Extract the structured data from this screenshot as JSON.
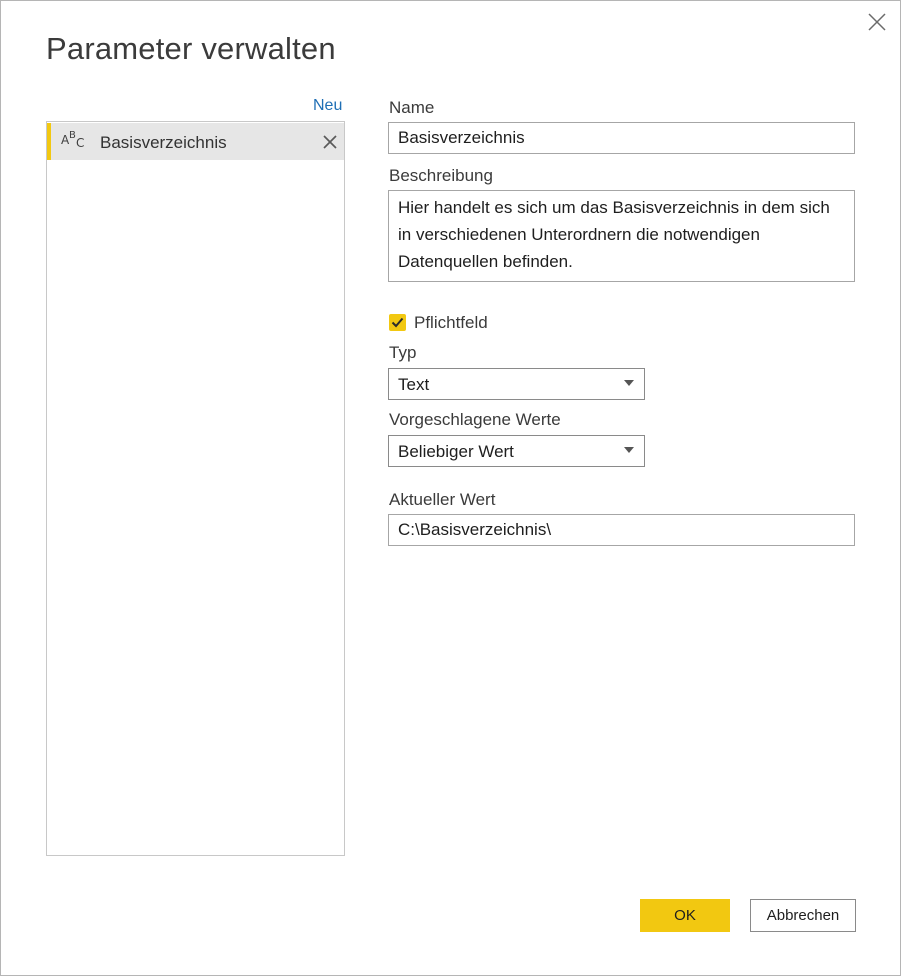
{
  "dialog": {
    "title": "Parameter verwalten",
    "close_icon": "close-icon"
  },
  "sidebar": {
    "new_label": "Neu",
    "items": [
      {
        "type_icon": "text-type-icon",
        "type_icon_letters": [
          "A",
          "B",
          "C"
        ],
        "label": "Basisverzeichnis",
        "delete_icon": "delete-icon",
        "selected": true
      }
    ]
  },
  "form": {
    "name_label": "Name",
    "name_value": "Basisverzeichnis",
    "description_label": "Beschreibung",
    "description_value": "Hier handelt es sich um das Basisverzeichnis in dem sich in verschiedenen Unterordnern die notwendigen Datenquellen befinden.",
    "required_label": "Pflichtfeld",
    "required_checked": true,
    "type_label": "Typ",
    "type_value": "Text",
    "suggested_label": "Vorgeschlagene Werte",
    "suggested_value": "Beliebiger Wert",
    "current_label": "Aktueller Wert",
    "current_value": "C:\\Basisverzeichnis\\"
  },
  "buttons": {
    "ok_label": "OK",
    "cancel_label": "Abbrechen"
  },
  "colors": {
    "accent": "#f2c811",
    "link": "#1f6fb5",
    "selected_row": "#e6e6e6"
  }
}
